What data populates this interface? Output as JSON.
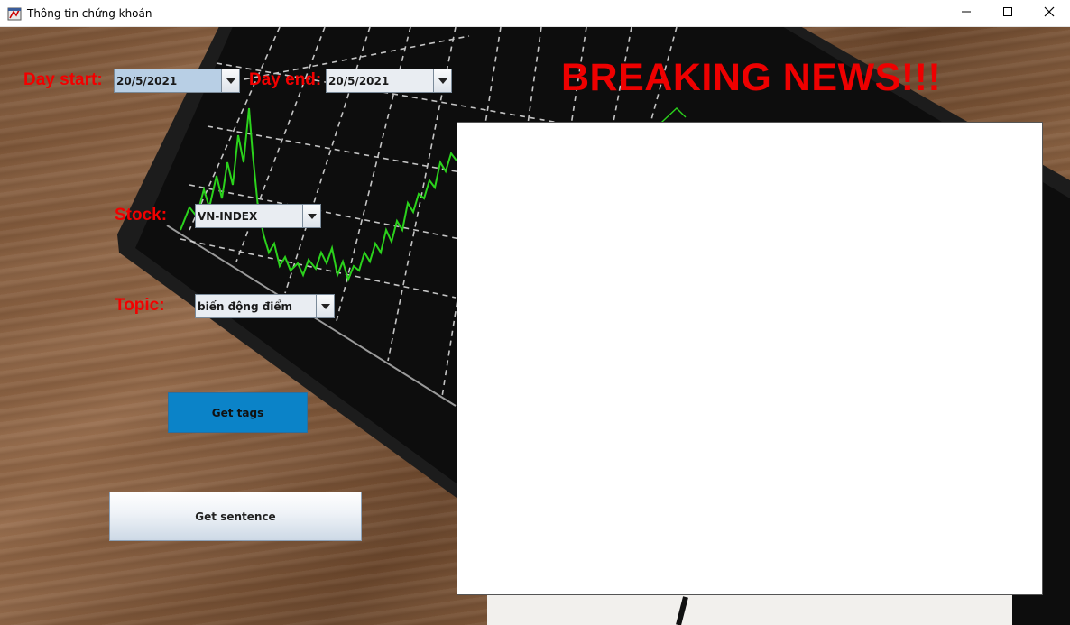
{
  "window": {
    "title": "Thông tin chứng khoán",
    "icon": "java-app-icon"
  },
  "controls": {
    "minimize_icon": "minimize-icon",
    "maximize_icon": "maximize-icon",
    "close_icon": "close-icon"
  },
  "form": {
    "day_start_label": "Day start:",
    "day_start_value": "20/5/2021",
    "day_end_label": "Day end:",
    "day_end_value": "20/5/2021",
    "stock_label": "Stock:",
    "stock_value": "VN-INDEX",
    "topic_label": "Topic:",
    "topic_value": "biến động điểm"
  },
  "buttons": {
    "get_tags": "Get tags",
    "get_sentence": "Get sentence"
  },
  "headline": "BREAKING NEWS!!!",
  "news_output": "",
  "colors": {
    "label_red": "#f20000",
    "get_tags_bg": "#0b83c8",
    "chart_green": "#2bd21c"
  }
}
